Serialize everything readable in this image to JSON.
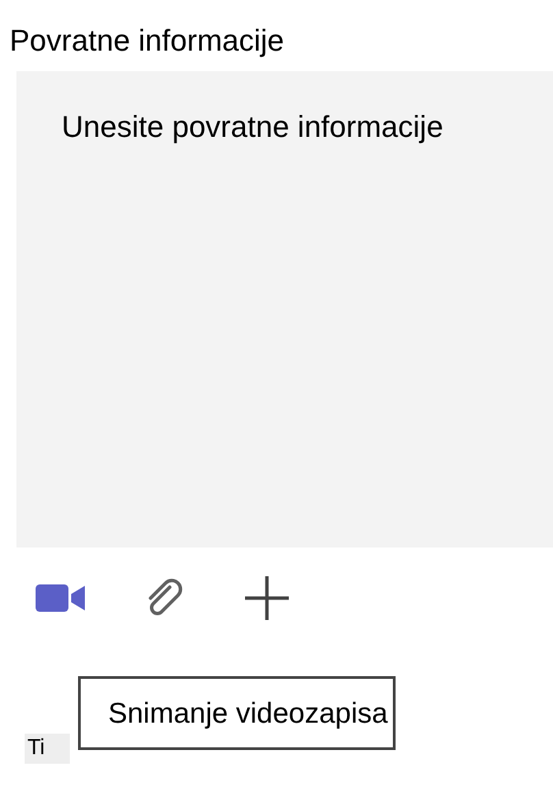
{
  "feedback_field": {
    "label": "Povratne informacije",
    "placeholder": "Unesite povratne informacije"
  },
  "toolbar": [
    {
      "kind": "video",
      "active": true
    },
    {
      "kind": "attach",
      "active": false
    },
    {
      "kind": "add",
      "active": false
    }
  ],
  "tooltip": {
    "text": "Snimanje videozapisa"
  },
  "badge": {
    "text": "Ti"
  }
}
